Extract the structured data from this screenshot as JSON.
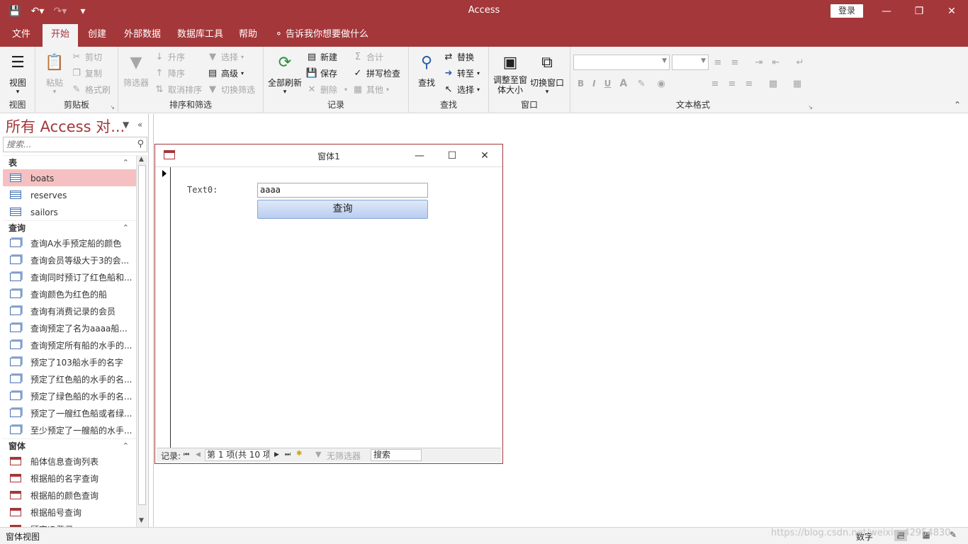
{
  "app": {
    "title": "Access",
    "login": "登录",
    "qat_icons": [
      "save-icon",
      "undo-icon",
      "redo-icon",
      "customize-qat-icon"
    ]
  },
  "ribbon_tabs": [
    {
      "label": "文件",
      "active": false
    },
    {
      "label": "开始",
      "active": true
    },
    {
      "label": "创建",
      "active": false
    },
    {
      "label": "外部数据",
      "active": false
    },
    {
      "label": "数据库工具",
      "active": false
    },
    {
      "label": "帮助",
      "active": false
    }
  ],
  "tell_me": "告诉我你想要做什么",
  "ribbon": {
    "view": {
      "label": "视图",
      "group": "视图"
    },
    "clipboard": {
      "paste": "粘贴",
      "cut": "剪切",
      "copy": "复制",
      "format_painter": "格式刷",
      "group": "剪贴板"
    },
    "sort_filter": {
      "filter": "筛选器",
      "asc": "升序",
      "desc": "降序",
      "clear_sort": "取消排序",
      "select": "选择",
      "advanced": "高级",
      "toggle_filter": "切换筛选",
      "group": "排序和筛选"
    },
    "records": {
      "refresh_all": "全部刷新",
      "new": "新建",
      "save": "保存",
      "delete": "删除",
      "totals": "合计",
      "spelling": "拼写检查",
      "more": "其他",
      "group": "记录"
    },
    "find": {
      "find": "查找",
      "replace": "替换",
      "goto": "转至",
      "select": "选择",
      "group": "查找"
    },
    "window": {
      "size_to_fit": "调整至窗体大小",
      "switch_windows": "切换窗口",
      "group": "窗口"
    },
    "text_format": {
      "bold": "B",
      "italic": "I",
      "underline": "U",
      "font_color": "A",
      "group": "文本格式"
    }
  },
  "nav": {
    "title": "所有 Access 对...",
    "search_placeholder": "搜索...",
    "sections": {
      "tables": {
        "label": "表",
        "items": [
          {
            "label": "boats",
            "selected": true
          },
          {
            "label": "reserves"
          },
          {
            "label": "sailors"
          }
        ]
      },
      "queries": {
        "label": "查询",
        "items": [
          {
            "label": "查询A水手预定船的颜色"
          },
          {
            "label": "查询会员等级大于3的会..."
          },
          {
            "label": "查询同时预订了红色船和..."
          },
          {
            "label": "查询颜色为红色的船"
          },
          {
            "label": "查询有消费记录的会员"
          },
          {
            "label": "查询预定了名为aaaa船..."
          },
          {
            "label": "查询预定所有船的水手的..."
          },
          {
            "label": "预定了103船水手的名字"
          },
          {
            "label": "预定了红色船的水手的名..."
          },
          {
            "label": "预定了绿色船的水手的名..."
          },
          {
            "label": "预定了一艘红色船或者绿..."
          },
          {
            "label": "至少预定了一艘船的水手..."
          }
        ]
      },
      "forms": {
        "label": "窗体",
        "items": [
          {
            "label": "船体信息查询列表"
          },
          {
            "label": "根据船的名字查询"
          },
          {
            "label": "根据船的颜色查询"
          },
          {
            "label": "根据船号查询"
          },
          {
            "label": "顾客ID登录"
          }
        ]
      }
    }
  },
  "form_window": {
    "title": "窗体1",
    "label": "Text0:",
    "textbox_value": "aaaa",
    "button": "查询",
    "record_nav": {
      "label": "记录:",
      "position": "第 1 项(共 10 项",
      "filter": "无筛选器",
      "search": "搜索"
    }
  },
  "status": {
    "mode": "窗体视图",
    "numlock": "数字"
  },
  "watermark": "https://blog.csdn.net/weixin_42954830",
  "colors": {
    "accent": "#a4373a",
    "selected": "#f5c0c1",
    "ribbon_bg": "#f3f3f3"
  }
}
